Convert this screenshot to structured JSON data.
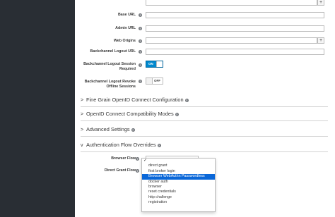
{
  "form": {
    "base_url_label": "Base URL",
    "admin_url_label": "Admin URL",
    "web_origins_label": "Web Origins",
    "backchannel_logout_url_label": "Backchannel Logout URL",
    "backchannel_logout_session_required_label": "Backchannel Logout Session Required",
    "backchannel_logout_session_required_value": "ON",
    "backchannel_logout_revoke_offline_label": "Backchannel Logout Revoke Offline Sessions",
    "backchannel_logout_revoke_offline_value": "OFF",
    "plus_glyph": "+",
    "help_glyph": "?"
  },
  "sections": [
    {
      "label": "Fine Grain OpenID Connect Configuration",
      "expanded": false
    },
    {
      "label": "OpenID Connect Compatibility Modes",
      "expanded": false
    },
    {
      "label": "Advanced Settings",
      "expanded": false
    },
    {
      "label": "Authentication Flow Overrides",
      "expanded": true
    }
  ],
  "chevrons": {
    "collapsed": ">",
    "expanded": "v"
  },
  "overrides": {
    "browser_flow_label": "Browser Flow",
    "direct_grant_flow_label": "Direct Grant Flow",
    "check_glyph": "✓",
    "browser_flow_options": [
      "",
      "direct grant",
      "first broker login",
      "Browser WebAuthn Passwordless",
      "docker auth",
      "browser",
      "reset credentials",
      "http challenge",
      "registration"
    ],
    "selected_index": 0,
    "highlighted_index": 3
  },
  "colors": {
    "sidebar_bg": "#292e34",
    "toggle_on": "#0088ce",
    "highlight": "#0a67d8"
  }
}
